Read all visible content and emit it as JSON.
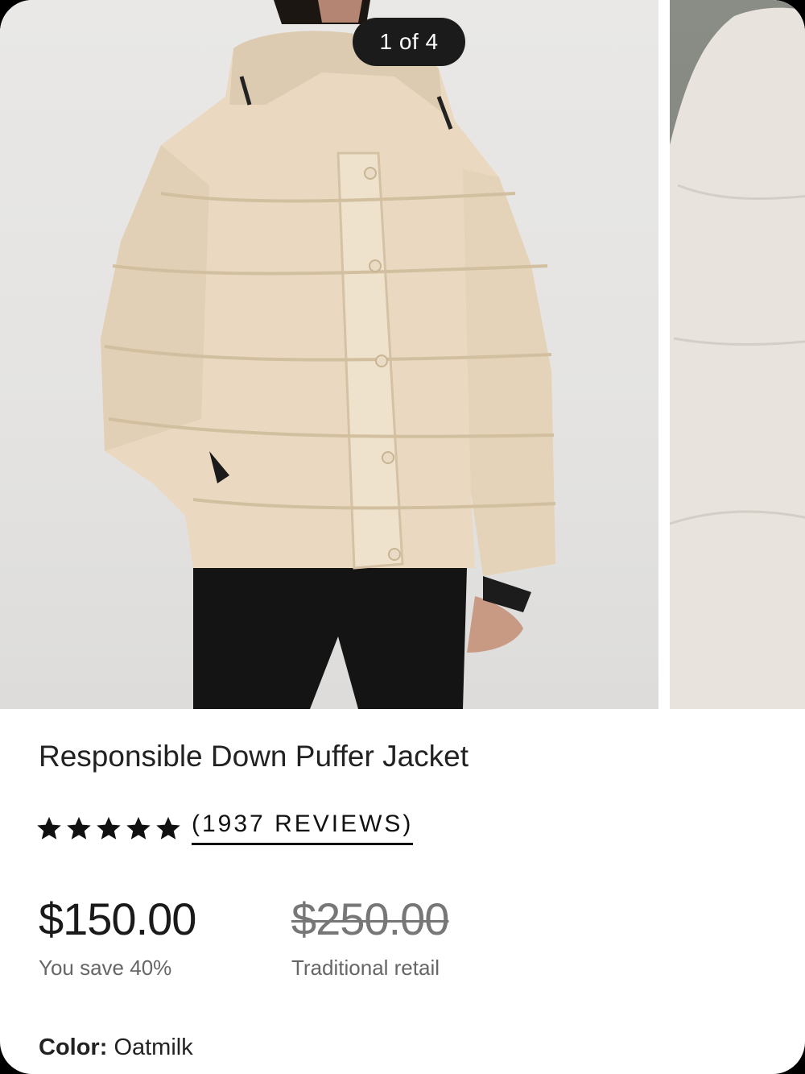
{
  "gallery": {
    "counter": "1 of 4",
    "images": [
      {
        "name": "jacket-front-photo"
      },
      {
        "name": "jacket-detail-photo"
      }
    ]
  },
  "product": {
    "title": "Responsible Down Puffer Jacket",
    "rating": 5,
    "reviews": "(1937 REVIEWS)",
    "price": "$150.00",
    "savings": "You save 40%",
    "retail_price": "$250.00",
    "retail_label": "Traditional retail",
    "color_label": "Color:",
    "color_value": "Oatmilk"
  },
  "colors": {
    "jacket": "#e9dcc6",
    "counter_bg": "#1b1b1b"
  }
}
